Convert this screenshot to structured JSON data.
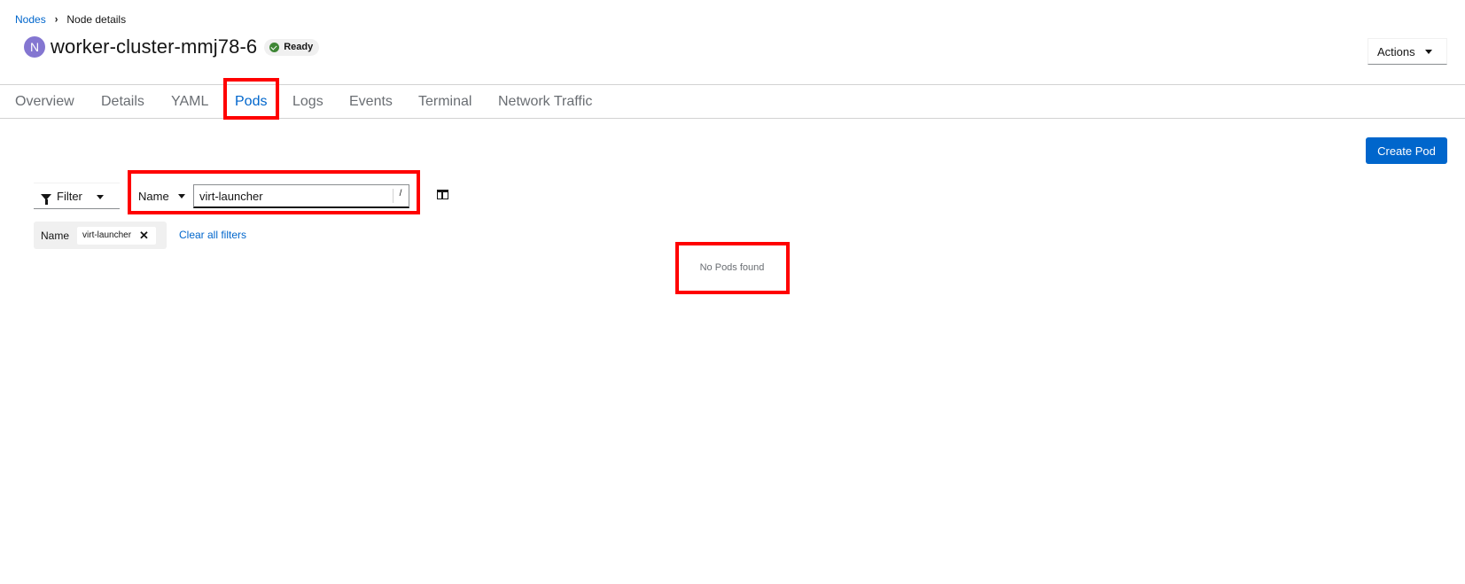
{
  "breadcrumb": {
    "parent": "Nodes",
    "current": "Node details"
  },
  "header": {
    "badge_letter": "N",
    "title": "worker-cluster-mmj78-6",
    "status": "Ready",
    "actions_label": "Actions"
  },
  "tabs": [
    {
      "label": "Overview"
    },
    {
      "label": "Details"
    },
    {
      "label": "YAML"
    },
    {
      "label": "Pods",
      "active": true
    },
    {
      "label": "Logs"
    },
    {
      "label": "Events"
    },
    {
      "label": "Terminal"
    },
    {
      "label": "Network Traffic"
    }
  ],
  "toolbar": {
    "create_label": "Create Pod",
    "filter_label": "Filter",
    "filter_type": "Name",
    "search_value": "virt-launcher",
    "shortcut_hint": "/"
  },
  "chips": {
    "group_label": "Name",
    "items": [
      {
        "label": "virt-launcher"
      }
    ],
    "clear_label": "Clear all filters"
  },
  "empty_state": {
    "message": "No Pods found"
  },
  "colors": {
    "link": "#0066cc",
    "primary": "#0066cc",
    "badge": "#8476d1",
    "status_ok": "#3e8635",
    "highlight": "#ff0000"
  }
}
